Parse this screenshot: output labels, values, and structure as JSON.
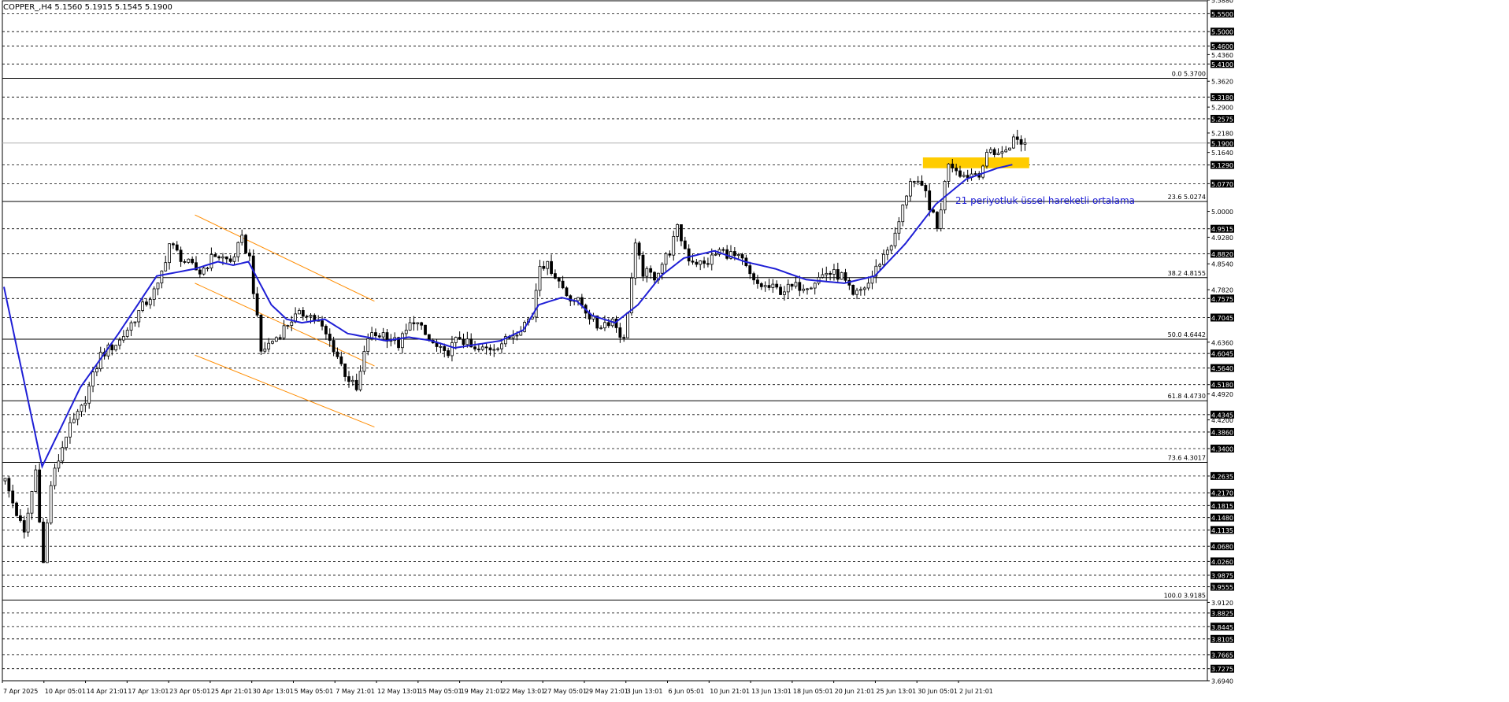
{
  "chart_data": {
    "type": "candlestick",
    "symbol": "COPPER_,H4",
    "ohlc_readout": {
      "open": "5.1560",
      "high": "5.1915",
      "low": "5.1545",
      "close": "5.1900"
    },
    "header_text": "COPPER_,H4  5.1560 5.1915 5.1545 5.1900",
    "ylim": [
      3.694,
      5.588
    ],
    "price_scale_labels": [
      "5.5880",
      "5.5500",
      "5.5000",
      "5.4600",
      "5.4360",
      "5.4100",
      "5.3620",
      "5.3180",
      "5.2900",
      "5.2575",
      "5.2180",
      "5.1900",
      "5.1640",
      "5.1290",
      "5.0770",
      "5.0000",
      "4.9515",
      "4.9280",
      "4.8820",
      "4.8540",
      "4.7820",
      "4.7575",
      "4.7045",
      "4.6360",
      "4.6045",
      "4.5640",
      "4.5180",
      "4.4920",
      "4.4345",
      "4.4200",
      "4.3860",
      "4.3400",
      "4.2635",
      "4.2170",
      "4.1815",
      "4.1480",
      "4.1135",
      "4.0680",
      "4.0260",
      "3.9875",
      "3.9555",
      "3.9120",
      "3.8825",
      "3.8445",
      "3.8105",
      "3.7665",
      "3.7275",
      "3.6940"
    ],
    "dashed_levels": [
      5.55,
      5.5,
      5.46,
      5.41,
      5.318,
      5.2575,
      5.129,
      5.077,
      4.9515,
      4.882,
      4.7575,
      4.7045,
      4.6045,
      4.564,
      4.518,
      4.4345,
      4.386,
      4.34,
      4.2635,
      4.217,
      4.1815,
      4.148,
      4.1135,
      4.068,
      4.026,
      3.9875,
      3.9555,
      3.8825,
      3.8445,
      3.8105,
      3.7665,
      3.7275
    ],
    "highlighted_labels": [
      "5.5500",
      "5.5000",
      "5.4600",
      "5.4100",
      "5.3180",
      "5.2575",
      "5.1900",
      "5.1290",
      "5.0770",
      "4.9515",
      "4.8820",
      "4.7575",
      "4.7045",
      "4.6045",
      "4.5640",
      "4.5180",
      "4.4345",
      "4.3860",
      "4.3400",
      "4.2635",
      "4.2170",
      "4.1815",
      "4.1480",
      "4.1135",
      "4.0680",
      "4.0260",
      "3.9875",
      "3.9555",
      "3.8825",
      "3.8445",
      "3.8105",
      "3.7665",
      "3.7275"
    ],
    "current_price": 5.19,
    "fibonacci": [
      {
        "label": "0.0 5.3700",
        "value": 5.37
      },
      {
        "label": "23.6 5.0274",
        "value": 5.0274
      },
      {
        "label": "38.2 4.8155",
        "value": 4.8155
      },
      {
        "label": "50.0 4.6442",
        "value": 4.6442
      },
      {
        "label": "61.8 4.4730",
        "value": 4.473
      },
      {
        "label": "73.6 4.3017",
        "value": 4.3017
      },
      {
        "label": "100.0 3.9185",
        "value": 3.9185
      }
    ],
    "time_labels": [
      "7 Apr 2025",
      "10 Apr 05:01",
      "14 Apr 21:01",
      "17 Apr 13:01",
      "23 Apr 05:01",
      "25 Apr 21:01",
      "30 Apr 13:01",
      "5 May 05:01",
      "7 May 21:01",
      "12 May 13:01",
      "15 May 05:01",
      "19 May 21:01",
      "22 May 13:01",
      "27 May 05:01",
      "29 May 21:01",
      "3 Jun 13:01",
      "6 Jun 05:01",
      "10 Jun 21:01",
      "13 Jun 13:01",
      "18 Jun 05:01",
      "20 Jun 21:01",
      "25 Jun 13:01",
      "30 Jun 05:01",
      "2 Jul 21:01"
    ],
    "bar_count": 316,
    "annotation": "21 periyotluk üssel hareketli ortalama",
    "path_anchors": [
      [
        0,
        4.25
      ],
      [
        5,
        4.1
      ],
      [
        8,
        4.28
      ],
      [
        10,
        4.02
      ],
      [
        12,
        4.24
      ],
      [
        16,
        4.38
      ],
      [
        20,
        4.45
      ],
      [
        25,
        4.6
      ],
      [
        30,
        4.64
      ],
      [
        35,
        4.72
      ],
      [
        40,
        4.79
      ],
      [
        43,
        4.91
      ],
      [
        47,
        4.86
      ],
      [
        51,
        4.83
      ],
      [
        55,
        4.88
      ],
      [
        59,
        4.86
      ],
      [
        62,
        4.92
      ],
      [
        64,
        4.87
      ],
      [
        67,
        4.61
      ],
      [
        71,
        4.65
      ],
      [
        75,
        4.7
      ],
      [
        79,
        4.72
      ],
      [
        82,
        4.69
      ],
      [
        86,
        4.62
      ],
      [
        89,
        4.55
      ],
      [
        92,
        4.5
      ],
      [
        95,
        4.65
      ],
      [
        99,
        4.66
      ],
      [
        103,
        4.63
      ],
      [
        107,
        4.7
      ],
      [
        111,
        4.64
      ],
      [
        115,
        4.6
      ],
      [
        119,
        4.65
      ],
      [
        123,
        4.61
      ],
      [
        127,
        4.62
      ],
      [
        131,
        4.64
      ],
      [
        134,
        4.67
      ],
      [
        138,
        4.71
      ],
      [
        140,
        4.86
      ],
      [
        143,
        4.84
      ],
      [
        147,
        4.77
      ],
      [
        151,
        4.74
      ],
      [
        155,
        4.68
      ],
      [
        159,
        4.7
      ],
      [
        162,
        4.64
      ],
      [
        165,
        4.9
      ],
      [
        167,
        4.83
      ],
      [
        170,
        4.82
      ],
      [
        174,
        4.89
      ],
      [
        176,
        4.95
      ],
      [
        179,
        4.87
      ],
      [
        183,
        4.85
      ],
      [
        187,
        4.89
      ],
      [
        190,
        4.88
      ],
      [
        193,
        4.86
      ],
      [
        196,
        4.8
      ],
      [
        199,
        4.79
      ],
      [
        203,
        4.78
      ],
      [
        207,
        4.79
      ],
      [
        211,
        4.8
      ],
      [
        215,
        4.83
      ],
      [
        219,
        4.82
      ],
      [
        222,
        4.76
      ],
      [
        226,
        4.8
      ],
      [
        229,
        4.86
      ],
      [
        233,
        4.93
      ],
      [
        237,
        5.09
      ],
      [
        241,
        5.05
      ],
      [
        244,
        4.95
      ],
      [
        247,
        5.14
      ],
      [
        251,
        5.1
      ],
      [
        255,
        5.11
      ],
      [
        258,
        5.17
      ],
      [
        261,
        5.16
      ],
      [
        264,
        5.2
      ],
      [
        267,
        5.19
      ]
    ],
    "ema_anchors": [
      [
        0,
        4.79
      ],
      [
        10,
        4.29
      ],
      [
        20,
        4.51
      ],
      [
        30,
        4.66
      ],
      [
        40,
        4.82
      ],
      [
        50,
        4.84
      ],
      [
        56,
        4.86
      ],
      [
        60,
        4.85
      ],
      [
        64,
        4.86
      ],
      [
        70,
        4.74
      ],
      [
        74,
        4.7
      ],
      [
        78,
        4.69
      ],
      [
        84,
        4.7
      ],
      [
        90,
        4.66
      ],
      [
        100,
        4.64
      ],
      [
        106,
        4.65
      ],
      [
        112,
        4.64
      ],
      [
        118,
        4.62
      ],
      [
        124,
        4.63
      ],
      [
        130,
        4.64
      ],
      [
        136,
        4.67
      ],
      [
        140,
        4.74
      ],
      [
        146,
        4.76
      ],
      [
        150,
        4.75
      ],
      [
        154,
        4.71
      ],
      [
        160,
        4.69
      ],
      [
        166,
        4.74
      ],
      [
        172,
        4.82
      ],
      [
        178,
        4.87
      ],
      [
        186,
        4.89
      ],
      [
        194,
        4.86
      ],
      [
        202,
        4.84
      ],
      [
        210,
        4.81
      ],
      [
        220,
        4.8
      ],
      [
        228,
        4.82
      ],
      [
        236,
        4.91
      ],
      [
        244,
        5.02
      ],
      [
        252,
        5.09
      ],
      [
        260,
        5.12
      ],
      [
        264,
        5.13
      ]
    ],
    "orange_channel": {
      "upper": [
        [
          50,
          4.99
        ],
        [
          97,
          4.75
        ]
      ],
      "middle": [
        [
          50,
          4.8
        ],
        [
          97,
          4.57
        ]
      ],
      "lower": [
        [
          50,
          4.6
        ],
        [
          97,
          4.4
        ]
      ]
    },
    "highlight_zone": {
      "from_bar": 241,
      "to_bar": 268,
      "price_low": 5.12,
      "price_high": 5.15,
      "color": "#ffcc00"
    },
    "colors": {
      "candle": "#000000",
      "ema": "#1f1fd6",
      "channel": "#ff8c00",
      "annotation": "#1f1fd6",
      "grid": "#000000",
      "price_label_bg": "#000000",
      "price_label_fg": "#ffffff"
    },
    "grid": true,
    "grid_style": "dashed horizontal"
  }
}
